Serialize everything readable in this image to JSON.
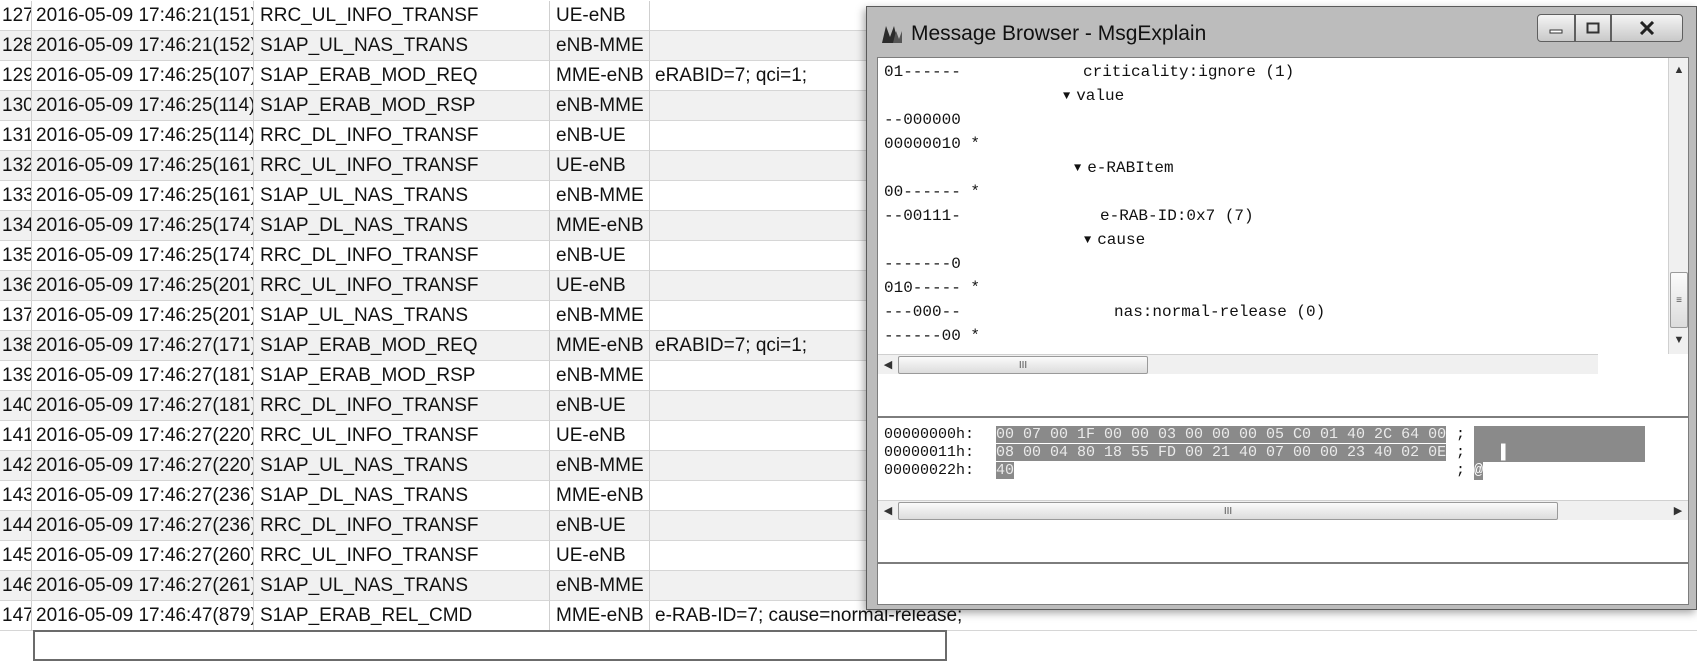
{
  "log_rows": [
    {
      "no": "127",
      "time": "2016-05-09 17:46:21(151)",
      "msg": "RRC_UL_INFO_TRANSF",
      "dir": "UE-eNB",
      "info": ""
    },
    {
      "no": "128",
      "time": "2016-05-09 17:46:21(152)",
      "msg": "S1AP_UL_NAS_TRANS",
      "dir": "eNB-MME",
      "info": ""
    },
    {
      "no": "129",
      "time": "2016-05-09 17:46:25(107)",
      "msg": "S1AP_ERAB_MOD_REQ",
      "dir": "MME-eNB",
      "info": "eRABID=7; qci=1;"
    },
    {
      "no": "130",
      "time": "2016-05-09 17:46:25(114)",
      "msg": "S1AP_ERAB_MOD_RSP",
      "dir": "eNB-MME",
      "info": ""
    },
    {
      "no": "131",
      "time": "2016-05-09 17:46:25(114)",
      "msg": "RRC_DL_INFO_TRANSF",
      "dir": "eNB-UE",
      "info": ""
    },
    {
      "no": "132",
      "time": "2016-05-09 17:46:25(161)",
      "msg": "RRC_UL_INFO_TRANSF",
      "dir": "UE-eNB",
      "info": ""
    },
    {
      "no": "133",
      "time": "2016-05-09 17:46:25(161)",
      "msg": "S1AP_UL_NAS_TRANS",
      "dir": "eNB-MME",
      "info": ""
    },
    {
      "no": "134",
      "time": "2016-05-09 17:46:25(174)",
      "msg": "S1AP_DL_NAS_TRANS",
      "dir": "MME-eNB",
      "info": ""
    },
    {
      "no": "135",
      "time": "2016-05-09 17:46:25(174)",
      "msg": "RRC_DL_INFO_TRANSF",
      "dir": "eNB-UE",
      "info": ""
    },
    {
      "no": "136",
      "time": "2016-05-09 17:46:25(201)",
      "msg": "RRC_UL_INFO_TRANSF",
      "dir": "UE-eNB",
      "info": ""
    },
    {
      "no": "137",
      "time": "2016-05-09 17:46:25(201)",
      "msg": "S1AP_UL_NAS_TRANS",
      "dir": "eNB-MME",
      "info": ""
    },
    {
      "no": "138",
      "time": "2016-05-09 17:46:27(171)",
      "msg": "S1AP_ERAB_MOD_REQ",
      "dir": "MME-eNB",
      "info": "eRABID=7; qci=1;"
    },
    {
      "no": "139",
      "time": "2016-05-09 17:46:27(181)",
      "msg": "S1AP_ERAB_MOD_RSP",
      "dir": "eNB-MME",
      "info": ""
    },
    {
      "no": "140",
      "time": "2016-05-09 17:46:27(181)",
      "msg": "RRC_DL_INFO_TRANSF",
      "dir": "eNB-UE",
      "info": ""
    },
    {
      "no": "141",
      "time": "2016-05-09 17:46:27(220)",
      "msg": "RRC_UL_INFO_TRANSF",
      "dir": "UE-eNB",
      "info": ""
    },
    {
      "no": "142",
      "time": "2016-05-09 17:46:27(220)",
      "msg": "S1AP_UL_NAS_TRANS",
      "dir": "eNB-MME",
      "info": ""
    },
    {
      "no": "143",
      "time": "2016-05-09 17:46:27(236)",
      "msg": "S1AP_DL_NAS_TRANS",
      "dir": "MME-eNB",
      "info": ""
    },
    {
      "no": "144",
      "time": "2016-05-09 17:46:27(236)",
      "msg": "RRC_DL_INFO_TRANSF",
      "dir": "eNB-UE",
      "info": ""
    },
    {
      "no": "145",
      "time": "2016-05-09 17:46:27(260)",
      "msg": "RRC_UL_INFO_TRANSF",
      "dir": "UE-eNB",
      "info": ""
    },
    {
      "no": "146",
      "time": "2016-05-09 17:46:27(261)",
      "msg": "S1AP_UL_NAS_TRANS",
      "dir": "eNB-MME",
      "info": ""
    },
    {
      "no": "147",
      "time": "2016-05-09 17:46:47(879)",
      "msg": "S1AP_ERAB_REL_CMD",
      "dir": "MME-eNB",
      "info": "e-RAB-ID=7; cause=normal-release;"
    }
  ],
  "window": {
    "title": "Message Browser - MsgExplain"
  },
  "tree_lines": [
    {
      "bits": "01------",
      "node": "criticality:ignore (1)",
      "indent": 205,
      "caret": false
    },
    {
      "bits": "",
      "node": "value",
      "indent": 185,
      "caret": true
    },
    {
      "bits": "--000000",
      "node": "",
      "indent": 0,
      "caret": false
    },
    {
      "bits": "00000010 *",
      "node": "",
      "indent": 0,
      "caret": false
    },
    {
      "bits": "",
      "node": "e-RABItem",
      "indent": 196,
      "caret": true
    },
    {
      "bits": "00------ *",
      "node": "",
      "indent": 0,
      "caret": false
    },
    {
      "bits": "--00111-",
      "node": "e-RAB-ID:0x7 (7)",
      "indent": 222,
      "caret": false
    },
    {
      "bits": "",
      "node": "cause",
      "indent": 206,
      "caret": true
    },
    {
      "bits": "-------0",
      "node": "",
      "indent": 0,
      "caret": false
    },
    {
      "bits": "010----- *",
      "node": "",
      "indent": 0,
      "caret": false
    },
    {
      "bits": "---000--",
      "node": "nas:normal-release (0)",
      "indent": 236,
      "caret": false
    },
    {
      "bits": "------00 *",
      "node": "",
      "indent": 0,
      "caret": false
    }
  ],
  "tree_scroll_grip": "III",
  "hex_lines": [
    {
      "offset": "00000000h:",
      "bytes": "00 07 00 1F 00 00 03 00 00 00 05 C0 01 40 2C 64 00",
      "ascii": "                   "
    },
    {
      "offset": "00000011h:",
      "bytes": "08 00 04 80 18 55 FD 00 21 40 07 00 00 23 40 02 0E",
      "ascii": "   ▌               "
    },
    {
      "offset": "00000022h:",
      "bytes": "40",
      "ascii": "@"
    }
  ],
  "hex_separator": ";",
  "hex_scroll_grip": "III"
}
